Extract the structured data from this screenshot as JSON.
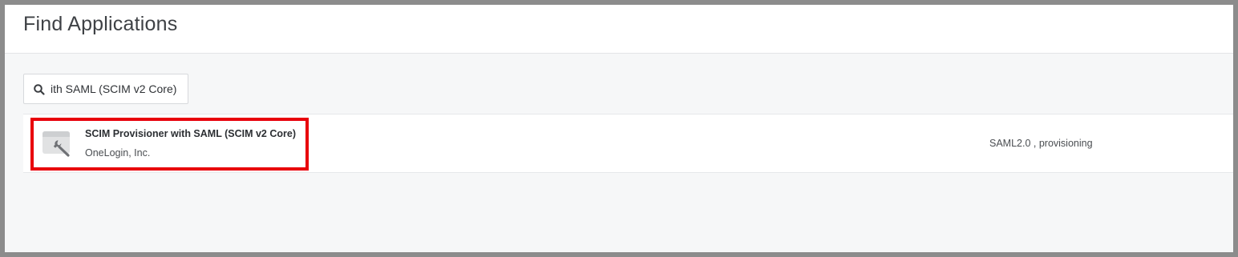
{
  "header": {
    "title": "Find Applications"
  },
  "search": {
    "value": "ith SAML (SCIM v2 Core)",
    "icon": "search-icon"
  },
  "results": [
    {
      "name": "SCIM Provisioner with SAML (SCIM v2 Core)",
      "vendor": "OneLogin, Inc.",
      "tags": "SAML2.0 , provisioning",
      "icon": "wrench-app-icon"
    }
  ],
  "highlight": {
    "color": "#e8000b"
  }
}
